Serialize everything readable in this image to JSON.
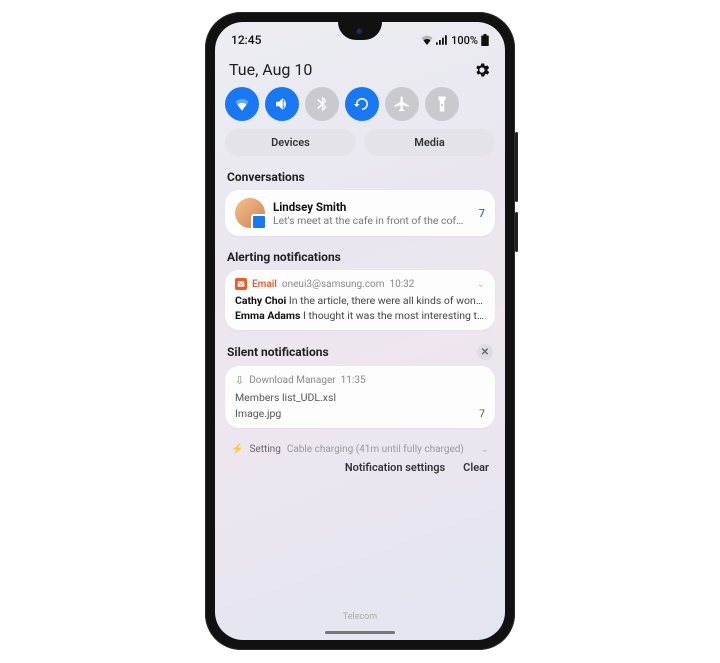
{
  "status": {
    "time": "12:45",
    "battery_pct": "100%"
  },
  "header": {
    "date": "Tue, Aug 10"
  },
  "qs": {
    "wifi": {
      "on": true
    },
    "sound": {
      "on": true
    },
    "bluetooth": {
      "on": false
    },
    "rotate": {
      "on": true
    },
    "airplane": {
      "on": false
    },
    "flashlight": {
      "on": false
    }
  },
  "buttons": {
    "devices": "Devices",
    "media": "Media"
  },
  "sections": {
    "conversations": "Conversations",
    "alerting": "Alerting notifications",
    "silent": "Silent notifications"
  },
  "conversation": {
    "name": "Lindsey Smith",
    "message": "Let's meet at the cafe in front of the coff…",
    "count": "7"
  },
  "email": {
    "app": "Email",
    "account": "oneui3@samsung.com",
    "time": "10:32",
    "items": [
      {
        "sender": "Cathy Choi",
        "preview": "In the article, there were all kinds of wond…"
      },
      {
        "sender": "Emma Adams",
        "preview": "I thought it was the most interesting th…"
      }
    ]
  },
  "download": {
    "app": "Download Manager",
    "time": "11:35",
    "files": [
      {
        "name": "Members list_UDL.xsl",
        "right": ""
      },
      {
        "name": "Image.jpg",
        "right": "7"
      }
    ]
  },
  "setting": {
    "label": "Setting",
    "text": "Cable charging (41m until fully charged)"
  },
  "footer": {
    "settings": "Notification settings",
    "clear": "Clear"
  },
  "carrier": "Telecom"
}
